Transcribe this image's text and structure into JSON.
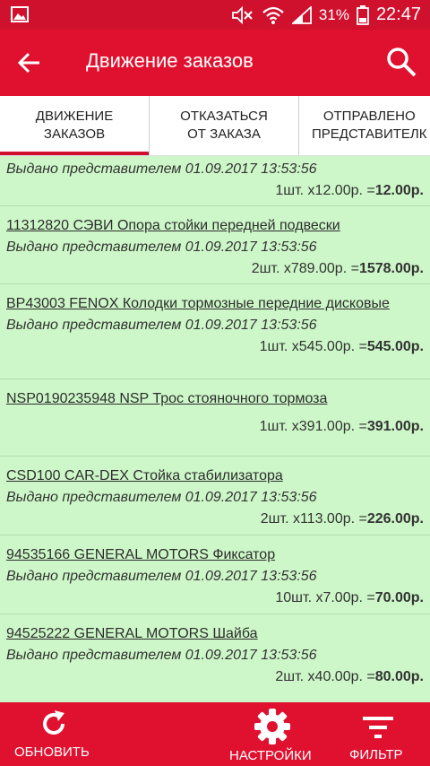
{
  "status_bar": {
    "battery": "31%",
    "time": "22:47"
  },
  "app_bar": {
    "title": "Движение заказов"
  },
  "tabs": [
    {
      "label": "ДВИЖЕНИЕ\nЗАКАЗОВ",
      "active": true
    },
    {
      "label": "ОТКАЗАТЬСЯ\nОТ ЗАКАЗА",
      "active": false
    },
    {
      "label": "ОТПРАВЛЕНО\nПРЕДСТАВИТЕЛК",
      "active": false
    }
  ],
  "items": [
    {
      "name": "",
      "status": "Выдано представителем  01.09.2017 13:53:56",
      "qty": "1шт. x12.00р. =",
      "sum": "12.00р."
    },
    {
      "name": "11312820 СЭВИ Опора стойки передней подвески ",
      "status": "Выдано представителем  01.09.2017 13:53:56",
      "qty": "2шт. x789.00р. =",
      "sum": "1578.00р."
    },
    {
      "name": "BP43003 FENOX Колодки тормозные передние дисковые ",
      "status": "Выдано представителем  01.09.2017 13:53:56",
      "qty": "1шт. x545.00р. =",
      "sum": "545.00р."
    },
    {
      "name": "NSP0190235948 NSP Трос стояночного тормоза ",
      "status": "",
      "qty": "1шт. x391.00р. =",
      "sum": "391.00р."
    },
    {
      "name": "CSD100 CAR-DEX Стойка стабилизатора ",
      "status": "Выдано представителем  01.09.2017 13:53:56",
      "qty": "2шт. x113.00р. =",
      "sum": "226.00р."
    },
    {
      "name": "94535166 GENERAL MOTORS Фиксатор ",
      "status": "Выдано представителем  01.09.2017 13:53:56",
      "qty": "10шт. x7.00р. =",
      "sum": "70.00р."
    },
    {
      "name": "94525222 GENERAL MOTORS Шайба ",
      "status": "Выдано представителем  01.09.2017 13:53:56",
      "qty": "2шт. x40.00р. =",
      "sum": "80.00р."
    }
  ],
  "bottom_bar": {
    "refresh_label": "ОБНОВИТЬ",
    "settings_label": "НАСТРОЙКИ",
    "filter_label": "ФИЛЬТР"
  },
  "colors": {
    "primary": "#e0102f",
    "status_bar": "#d0112e",
    "list_bg": "#cdf7c8"
  }
}
